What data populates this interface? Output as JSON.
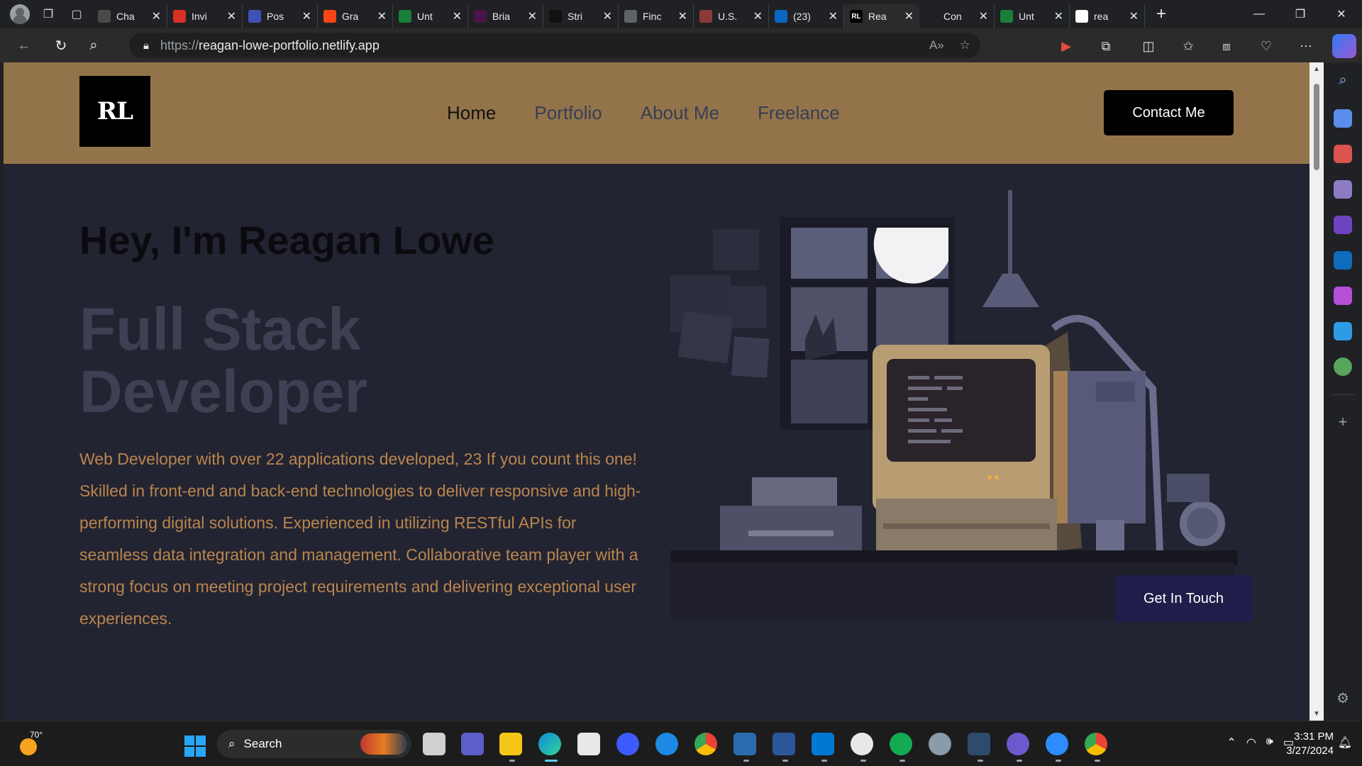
{
  "browser": {
    "tabs": [
      {
        "title": "Cha",
        "fav_color": "#4a4a4a"
      },
      {
        "title": "Invi",
        "fav_color": "#d93025"
      },
      {
        "title": "Pos",
        "fav_color": "#3f51b5"
      },
      {
        "title": "Gra",
        "fav_color": "#fa4616"
      },
      {
        "title": "Unt",
        "fav_color": "#188038"
      },
      {
        "title": "Bria",
        "fav_color": "#4a154b"
      },
      {
        "title": "Stri",
        "fav_color": "#111111"
      },
      {
        "title": "Finc",
        "fav_color": "#5f6368"
      },
      {
        "title": "U.S.",
        "fav_color": "#8b3a3a"
      },
      {
        "title": "(23)",
        "fav_color": "#0a66c2"
      },
      {
        "title": "Rea",
        "fav_color": "#000000",
        "fav_text": "RL",
        "active": true
      },
      {
        "title": "Con",
        "fav_color": "#202124"
      },
      {
        "title": "Unt",
        "fav_color": "#188038"
      },
      {
        "title": "rea",
        "fav_color": "#ffffff"
      }
    ],
    "url_protocol": "https://",
    "url_host": "reagan-lowe-portfolio.netlify.app"
  },
  "site": {
    "logo_text": "RL",
    "nav": [
      "Home",
      "Portfolio",
      "About Me",
      "Freelance"
    ],
    "contact_button": "Contact Me",
    "greeting": "Hey, I'm Reagan Lowe",
    "role_line1": "Full Stack",
    "role_line2": "Developer",
    "description": "Web Developer with over 22 applications developed, 23 If you count this one! Skilled in front-end and back-end technologies to deliver responsive and high-performing digital solutions. Experienced in utilizing RESTful APIs for seamless data integration and management. Collaborative team player with a strong focus on meeting project requirements and delivering exceptional user experiences.",
    "touch_button": "Get In Touch",
    "colors": {
      "header": "#93744a",
      "background": "#232431",
      "description": "#b9854f",
      "role": "#3d4153"
    }
  },
  "taskbar": {
    "weather_temp": "70°",
    "search_label": "Search",
    "time": "3:31 PM",
    "date": "3/27/2024"
  }
}
